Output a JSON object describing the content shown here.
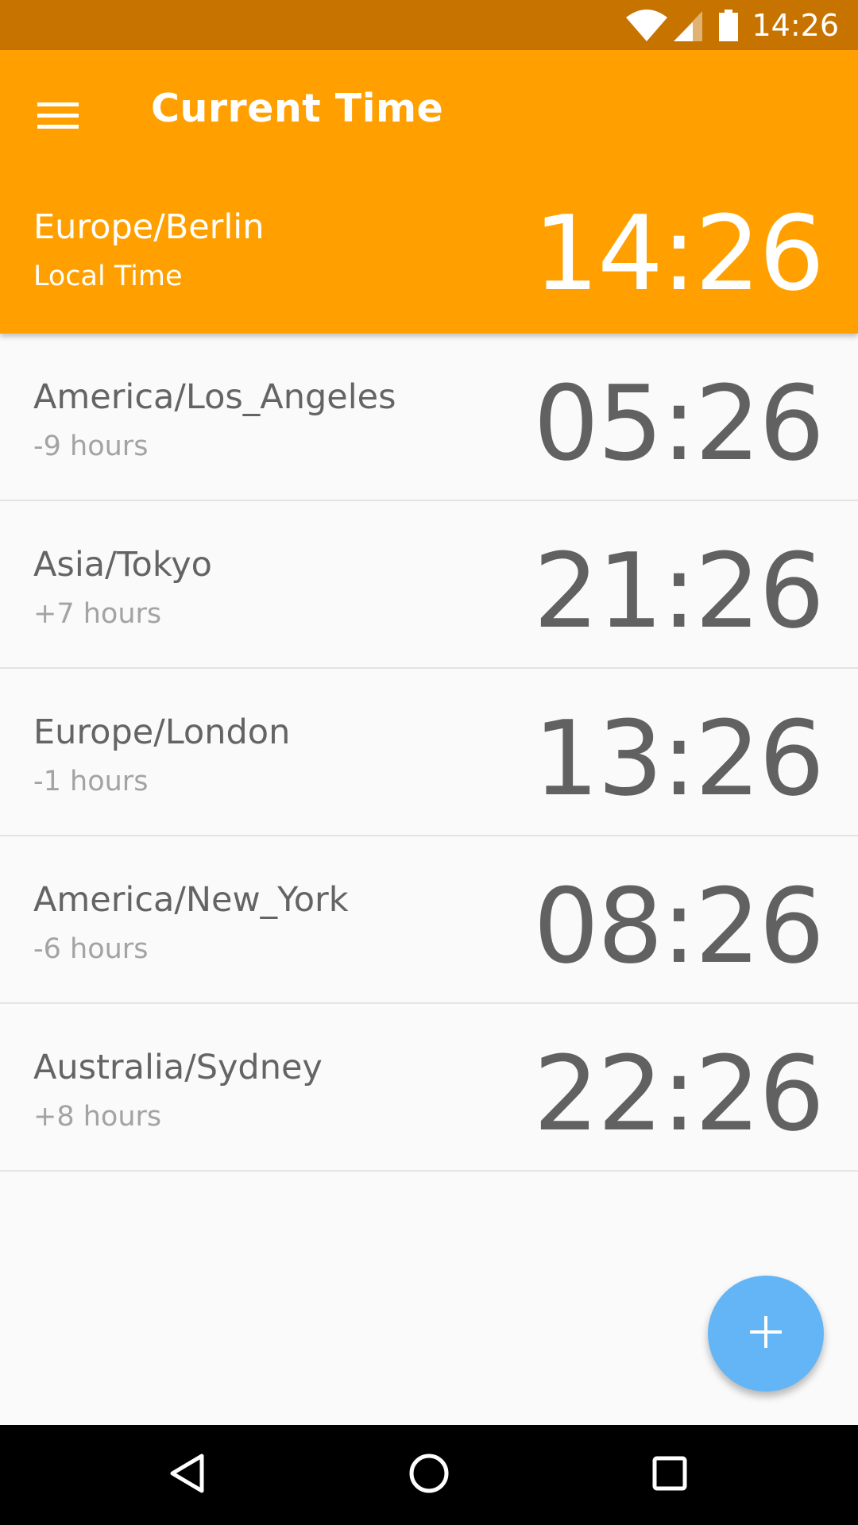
{
  "status_bar": {
    "time": "14:26",
    "icons": [
      "wifi-icon",
      "cell-signal-icon",
      "battery-icon"
    ]
  },
  "app_bar": {
    "title": "Current Time",
    "menu_icon": "menu-icon"
  },
  "local": {
    "zone": "Europe/Berlin",
    "label": "Local Time",
    "time": "14:26"
  },
  "zones": [
    {
      "name": "America/Los_Angeles",
      "offset": "-9 hours",
      "time": "05:26"
    },
    {
      "name": "Asia/Tokyo",
      "offset": "+7 hours",
      "time": "21:26"
    },
    {
      "name": "Europe/London",
      "offset": "-1 hours",
      "time": "13:26"
    },
    {
      "name": "America/New_York",
      "offset": "-6 hours",
      "time": "08:26"
    },
    {
      "name": "Australia/Sydney",
      "offset": "+8 hours",
      "time": "22:26"
    }
  ],
  "fab": {
    "icon": "plus-icon"
  },
  "nav_bar": {
    "icons": [
      "back-icon",
      "home-icon",
      "recents-icon"
    ]
  },
  "colors": {
    "status_bar": "#c67300",
    "app_bar": "#ffa000",
    "fab": "#64b5f6",
    "background": "#fafafa",
    "primary_text": "#646464",
    "secondary_text": "#a3a3a3"
  }
}
